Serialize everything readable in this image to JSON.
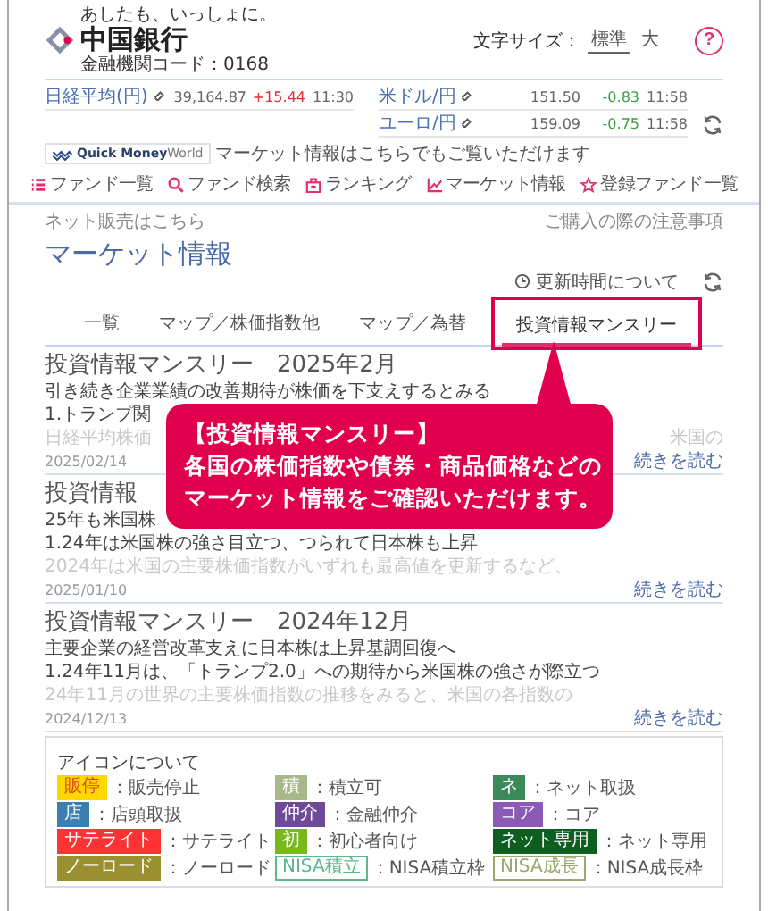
{
  "header": {
    "tagline": "あしたも、いっしょに。",
    "bank_name": "中国銀行",
    "bank_code": "金融機関コード：0168",
    "font_size_label": "文字サイズ：",
    "font_sizes": [
      {
        "label": "標準",
        "selected": true
      },
      {
        "label": "大",
        "selected": false
      }
    ],
    "help": "?"
  },
  "market": [
    {
      "name": "日経平均(円)",
      "value": "39,164.87",
      "change": "+15.44",
      "rising": true,
      "time": "11:30"
    },
    {
      "name": "米ドル/円",
      "value": "151.50",
      "change": "-0.83",
      "rising": false,
      "time": "11:58"
    },
    {
      "name": "ユーロ/円",
      "value": "159.09",
      "change": "-0.75",
      "rising": false,
      "time": "11:58"
    }
  ],
  "quick": {
    "brand_bold": "Quick Money",
    "brand_light": "World",
    "text": "マーケット情報はこちらでもご覧いただけます"
  },
  "nav": [
    {
      "label": "ファンド一覧"
    },
    {
      "label": "ファンド検索"
    },
    {
      "label": "ランキング"
    },
    {
      "label": "マーケット情報"
    },
    {
      "label": "登録ファンド一覧"
    }
  ],
  "links": {
    "left": "ネット販売はこちら",
    "right": "ご購入の際の注意事項"
  },
  "title": "マーケット情報",
  "update_label": "更新時間について",
  "tabs": [
    {
      "label": "一覧",
      "selected": false,
      "highlighted": false
    },
    {
      "label": "マップ／株価指数他",
      "selected": false,
      "highlighted": false
    },
    {
      "label": "マップ／為替",
      "selected": false,
      "highlighted": false
    },
    {
      "label": "投資情報マンスリー",
      "selected": true,
      "highlighted": true
    }
  ],
  "articles": [
    {
      "title": "投資情報マンスリー　2025年2月",
      "lead": "引き続き企業業績の改善期待が株価を下支えするとみる",
      "point": "1.トランプ関",
      "excerpt": "日経平均株価",
      "excerpt_end": "米国の",
      "date": "2025/02/14",
      "more": "続きを読む"
    },
    {
      "title": "投資情報",
      "lead": "25年も米国株",
      "point": "1.24年は米国株の強さ目立つ、つられて日本株も上昇",
      "excerpt": "2024年は米国の主要株価指数がいずれも最高値を更新するなど、",
      "date": "2025/01/10",
      "more": "続きを読む"
    },
    {
      "title": "投資情報マンスリー　2024年12月",
      "lead": "主要企業の経営改革支えに日本株は上昇基調回復へ",
      "point": "1.24年11月は、「トランプ2.0」への期待から米国株の強さが際立つ",
      "excerpt": "24年11月の世界の主要株価指数の推移をみると、米国の各指数の",
      "date": "2024/12/13",
      "more": "続きを読む"
    }
  ],
  "callout": {
    "lines": [
      "【投資情報マンスリー】",
      "各国の株価指数や債券・商品価格などの",
      "マーケット情報をご確認いただけます。"
    ]
  },
  "legend": {
    "title": "アイコンについて",
    "items": [
      {
        "badge": "販停",
        "text": "：販売停止",
        "kind": "alert",
        "color": "#ffd800"
      },
      {
        "badge": "積",
        "text": "：積立可",
        "kind": "filled",
        "color": "#a8b88a"
      },
      {
        "badge": "ネ",
        "text": "：ネット取扱",
        "kind": "filled",
        "color": "#3a8a5a"
      },
      {
        "badge": "店",
        "text": "：店頭取扱",
        "kind": "filled",
        "color": "#3b7fb0"
      },
      {
        "badge": "仲介",
        "text": "：金融仲介",
        "kind": "filled",
        "color": "#6e4a98"
      },
      {
        "badge": "コア",
        "text": "：コア",
        "kind": "filled",
        "color": "#8a5ab4"
      },
      {
        "badge": "サテライト",
        "text": "：サテライト",
        "kind": "filled",
        "color": "#ff3333"
      },
      {
        "badge": "初",
        "text": "：初心者向け",
        "kind": "filled",
        "color": "#78b81a"
      },
      {
        "badge": "ネット専用",
        "text": "：ネット専用",
        "kind": "filled",
        "color": "#0d5e1f"
      },
      {
        "badge": "ノーロード",
        "text": "：ノーロード",
        "kind": "filled",
        "color": "#9a9030"
      },
      {
        "badge": "NISA積立",
        "text": "：NISA積立枠",
        "kind": "outline",
        "color": "#5cb88a"
      },
      {
        "badge": "NISA成長",
        "text": "：NISA成長枠",
        "kind": "outline",
        "color": "#9aa870"
      }
    ]
  }
}
